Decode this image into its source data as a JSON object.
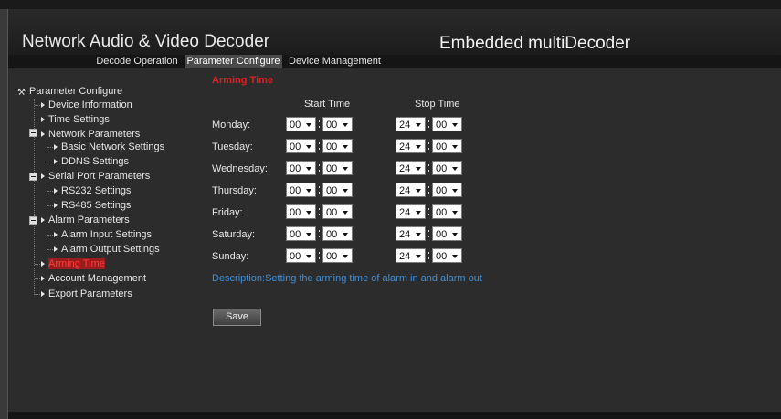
{
  "header": {
    "title": "Network Audio & Video Decoder",
    "subtitle": "Embedded multiDecoder"
  },
  "tabs": [
    {
      "label": "Decode Operation",
      "active": false
    },
    {
      "label": "Parameter Configure",
      "active": true
    },
    {
      "label": "Device Management",
      "active": false
    }
  ],
  "sidebar": {
    "root": "Parameter Configure",
    "items": [
      {
        "label": "Device Information"
      },
      {
        "label": "Time Settings"
      },
      {
        "label": "Network Parameters"
      },
      {
        "label": "Basic Network Settings"
      },
      {
        "label": "DDNS Settings"
      },
      {
        "label": "Serial Port Parameters"
      },
      {
        "label": "RS232 Settings"
      },
      {
        "label": "RS485 Settings"
      },
      {
        "label": "Alarm Parameters"
      },
      {
        "label": "Alarm Input Settings"
      },
      {
        "label": "Alarm Output Settings"
      },
      {
        "label": "Arming Time",
        "selected": true
      },
      {
        "label": "Account Management"
      },
      {
        "label": "Export Parameters"
      }
    ]
  },
  "main": {
    "section_title": "Arming Time",
    "start_header": "Start Time",
    "stop_header": "Stop Time",
    "rows": [
      {
        "day": "Monday:",
        "start_h": "00",
        "start_m": "00",
        "stop_h": "24",
        "stop_m": "00"
      },
      {
        "day": "Tuesday:",
        "start_h": "00",
        "start_m": "00",
        "stop_h": "24",
        "stop_m": "00"
      },
      {
        "day": "Wednesday:",
        "start_h": "00",
        "start_m": "00",
        "stop_h": "24",
        "stop_m": "00"
      },
      {
        "day": "Thursday:",
        "start_h": "00",
        "start_m": "00",
        "stop_h": "24",
        "stop_m": "00"
      },
      {
        "day": "Friday:",
        "start_h": "00",
        "start_m": "00",
        "stop_h": "24",
        "stop_m": "00"
      },
      {
        "day": "Saturday:",
        "start_h": "00",
        "start_m": "00",
        "stop_h": "24",
        "stop_m": "00"
      },
      {
        "day": "Sunday:",
        "start_h": "00",
        "start_m": "00",
        "stop_h": "24",
        "stop_m": "00"
      }
    ],
    "description": "Description:Setting the arming time of alarm in and alarm out",
    "save_label": "Save"
  },
  "colors": {
    "accent_red": "#e02020",
    "description_blue": "#3f8fd8",
    "panel_bg": "#2c2c2c"
  }
}
